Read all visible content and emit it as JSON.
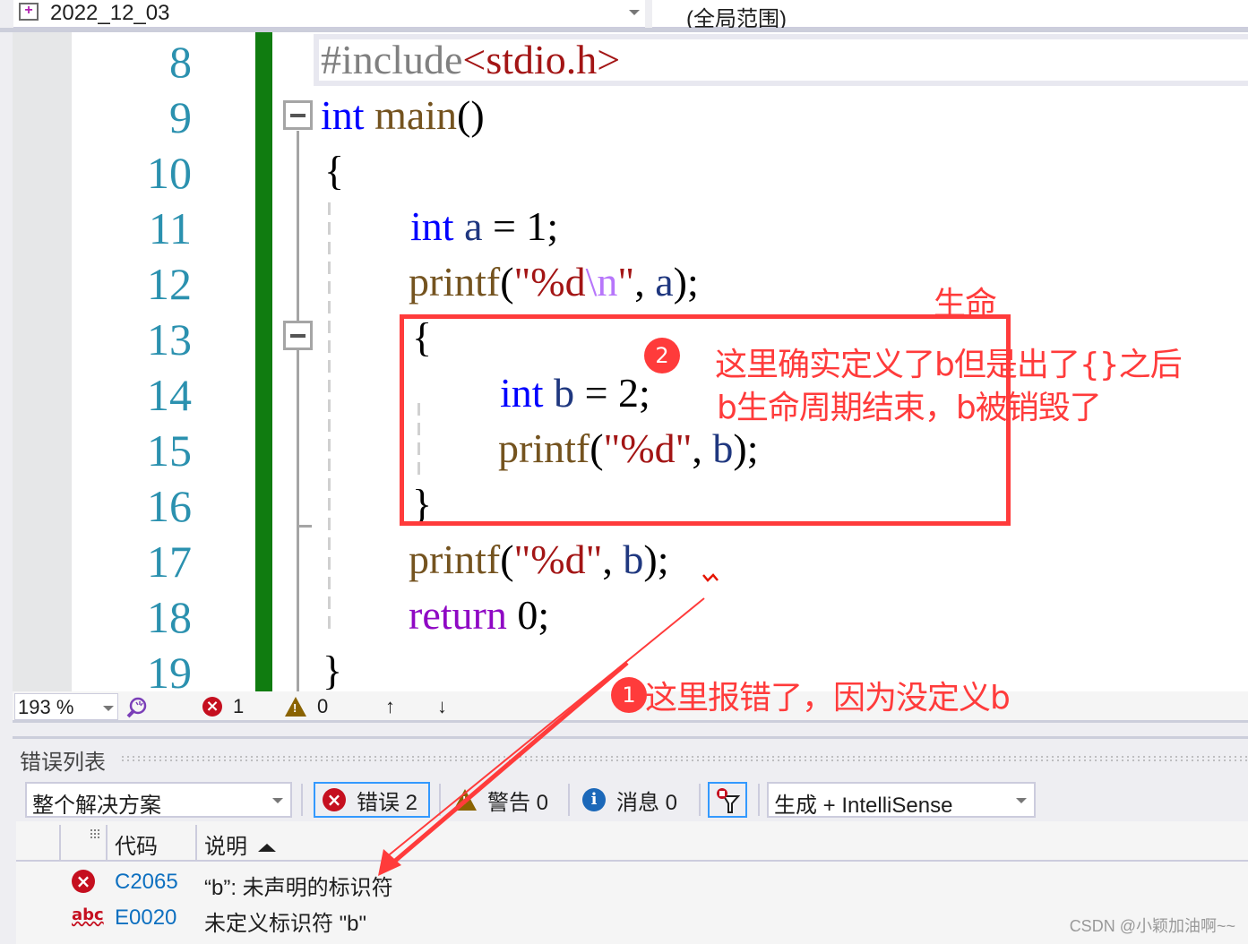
{
  "navbar": {
    "project_label": "2022_12_03",
    "scope_label": "(全局范围)"
  },
  "editor": {
    "line_numbers": [
      "8",
      "9",
      "10",
      "11",
      "12",
      "13",
      "14",
      "15",
      "16",
      "17",
      "18",
      "19"
    ],
    "code": {
      "l8": {
        "pp": "#include",
        "hdr": "<stdio.h>"
      },
      "l9": {
        "kw": "int",
        "fn": "main",
        "rest": "()"
      },
      "l10": "{",
      "l11": {
        "kw": "int",
        "var": "a",
        "eq": " = 1;"
      },
      "l12": {
        "fn": "printf",
        "open": "(",
        "str1": "\"%d",
        "esc": "\\n",
        "str2": "\"",
        "mid": ", ",
        "var": "a",
        "end": ");"
      },
      "l13": "{",
      "l14": {
        "kw": "int",
        "var": "b",
        "eq": " = 2;"
      },
      "l15": {
        "fn": "printf",
        "open": "(",
        "str": "\"%d\"",
        "mid": ", ",
        "var": "b",
        "end": ");"
      },
      "l16": "}",
      "l17": {
        "fn": "printf",
        "open": "(",
        "str": "\"%d\"",
        "mid": ", ",
        "var": "b",
        "end": ");"
      },
      "l18": {
        "ctl": "return",
        "rest": " 0;"
      },
      "l19": "}"
    }
  },
  "editor_status": {
    "zoom_level": "193 %",
    "error_count": "1",
    "warning_count": "0",
    "up_arrow": "↑",
    "down_arrow": "↓"
  },
  "error_list": {
    "title": "错误列表",
    "scope": "整个解决方案",
    "errors_button": "错误 2",
    "warnings_button": "警告 0",
    "messages_button": "消息 0",
    "source": "生成 + IntelliSense",
    "columns": {
      "code": "代码",
      "description": "说明"
    },
    "rows": [
      {
        "icon": "error",
        "code": "C2065",
        "description": "“b”: 未声明的标识符"
      },
      {
        "icon": "intellisense-abc",
        "code": "E0020",
        "description": "未定义标识符 \"b\""
      }
    ]
  },
  "annotations": {
    "lifetime_label": "生命",
    "badge_2": "2",
    "note_2_line1": "这里确实定义了b但是出了{}之后",
    "note_2_line2": "b生命周期结束，b被销毁了",
    "badge_1": "1",
    "note_1": "这里报错了，因为没定义b",
    "color": "#ff3b3b"
  },
  "watermark": "CSDN @小颖加油啊~~"
}
